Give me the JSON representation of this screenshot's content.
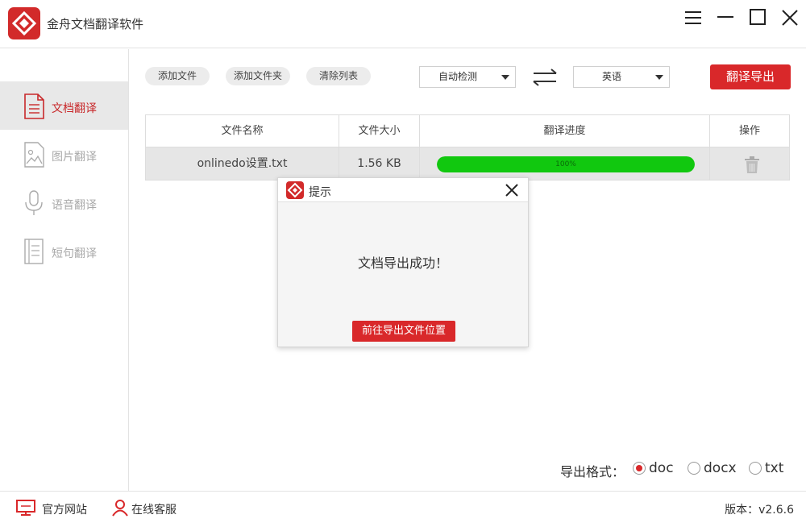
{
  "app": {
    "title": "金舟文档翻译软件"
  },
  "window_controls": {
    "icons": [
      "menu-icon",
      "minimize-icon",
      "maximize-icon",
      "close-icon"
    ]
  },
  "sidebar": {
    "items": [
      {
        "label": "文档翻译",
        "icon": "document-icon",
        "active": true
      },
      {
        "label": "图片翻译",
        "icon": "image-icon",
        "active": false
      },
      {
        "label": "语音翻译",
        "icon": "microphone-icon",
        "active": false
      },
      {
        "label": "短句翻译",
        "icon": "text-list-icon",
        "active": false
      }
    ]
  },
  "toolbar": {
    "add_file": "添加文件",
    "add_folder": "添加文件夹",
    "clear_list": "清除列表",
    "source_lang": "自动检测",
    "target_lang": "英语",
    "translate_export": "翻译导出"
  },
  "table": {
    "headers": [
      "文件名称",
      "文件大小",
      "翻译进度",
      "操作"
    ],
    "rows": [
      {
        "name": "onlinedo设置.txt",
        "size": "1.56 KB",
        "progress_label": "100%",
        "progress": 1.0
      }
    ]
  },
  "dialog": {
    "title": "提示",
    "message": "文档导出成功！",
    "button": "前往导出文件位置"
  },
  "export_format": {
    "label": "导出格式：",
    "options": [
      "doc",
      "docx",
      "txt"
    ],
    "selected": "doc"
  },
  "footer": {
    "website": "官方网站",
    "support": "在线客服",
    "version": "版本：v2.6.6"
  },
  "colors": {
    "accent": "#d9282a",
    "progress": "#11c80f",
    "active_sidebar_bg": "#e8e8e8"
  }
}
